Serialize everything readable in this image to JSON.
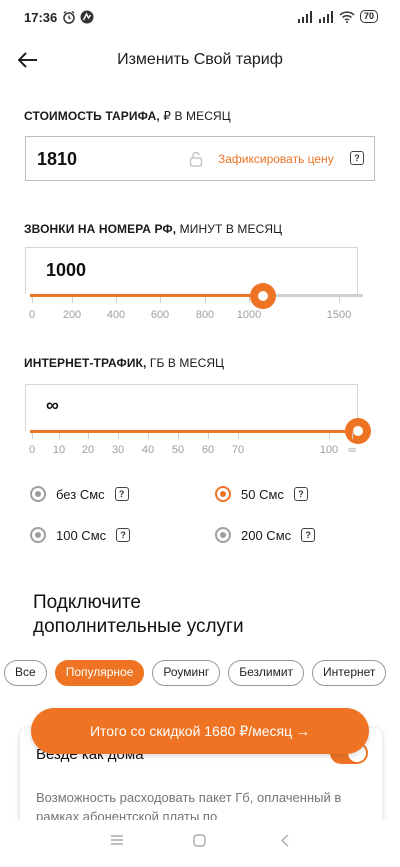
{
  "status": {
    "time": "17:36",
    "battery": "70"
  },
  "header": {
    "title": "Изменить Свой тариф"
  },
  "price": {
    "label_bold": "СТОИМОСТЬ ТАРИФА,",
    "label_rest": " ₽ В МЕСЯЦ",
    "value": "1810",
    "fix_label": "Зафиксировать цену",
    "help": "?"
  },
  "calls": {
    "label_bold": "ЗВОНКИ НА НОМЕРА РФ,",
    "label_rest": " МИНУТ В МЕСЯЦ",
    "value": "1000",
    "level_percent": 70,
    "ticks": [
      "0",
      "200",
      "400",
      "600",
      "800",
      "1000",
      "1500"
    ]
  },
  "internet": {
    "label_bold": "ИНТЕРНЕТ-ТРАФИК,",
    "label_rest": " ГБ В МЕСЯЦ",
    "value": "∞",
    "level_percent": 100,
    "ticks": [
      "0",
      "10",
      "20",
      "30",
      "40",
      "50",
      "60",
      "70",
      "100",
      "∞"
    ]
  },
  "sms": {
    "options": [
      "без Смс",
      "50 Смс",
      "100 Смс",
      "200 Смс"
    ],
    "selected": "50 Смс",
    "help": "?"
  },
  "services": {
    "title_line1": "Подключите",
    "title_line2": "дополнительные услуги",
    "chips": [
      "Все",
      "Популярное",
      "Роуминг",
      "Безлимит",
      "Интернет"
    ],
    "active_chip": "Популярное"
  },
  "card": {
    "title": "Везде как дома",
    "enabled": true,
    "description": "Возможность расходовать пакет Гб, оплаченный в рамках абонентской платы по"
  },
  "cta": {
    "label": "Итого со скидкой 1680 ₽/месяц →"
  },
  "colors": {
    "accent": "#ee7424",
    "inactive": "#9e9e9e"
  }
}
